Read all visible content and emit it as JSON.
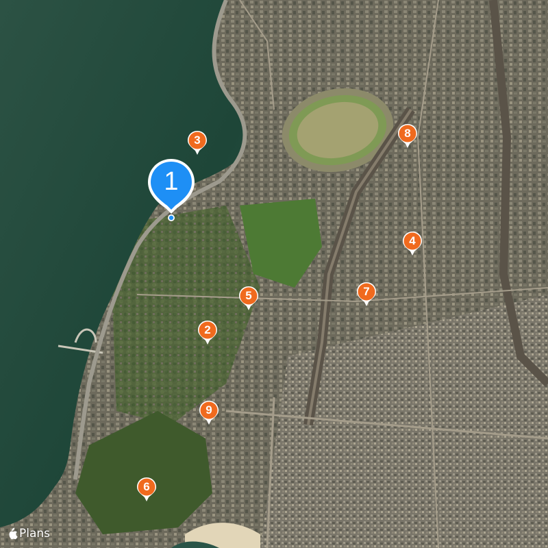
{
  "map": {
    "type": "satellite",
    "watermark": {
      "logo_icon": "apple-logo-icon",
      "label": "Plans"
    },
    "colors": {
      "sea": "#1f4a3a",
      "land": "#6b6b5a",
      "park": "#4b6a33",
      "selected_pin": "#1e8ff5",
      "pin": "#f06a1e"
    },
    "selected_pin": {
      "label": "1"
    },
    "pins": [
      {
        "id": "2",
        "label": "2"
      },
      {
        "id": "3",
        "label": "3"
      },
      {
        "id": "4",
        "label": "4"
      },
      {
        "id": "5",
        "label": "5"
      },
      {
        "id": "6",
        "label": "6"
      },
      {
        "id": "7",
        "label": "7"
      },
      {
        "id": "8",
        "label": "8"
      },
      {
        "id": "9",
        "label": "9"
      }
    ]
  }
}
